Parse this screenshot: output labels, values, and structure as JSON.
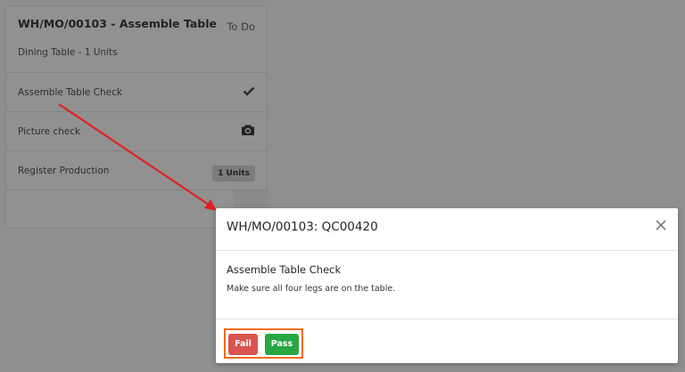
{
  "work_order": {
    "title": "WH/MO/00103 - Assemble Table",
    "state": "To Do",
    "subtitle": "Dining Table - 1 Units",
    "steps": [
      {
        "label": "Assemble Table Check",
        "icon": "checkmark-icon"
      },
      {
        "label": "Picture check",
        "icon": "camera-icon"
      },
      {
        "label": "Register Production",
        "badge": "1 Units"
      }
    ]
  },
  "dialog": {
    "title": "WH/MO/00103: QC00420",
    "check_title": "Assemble Table Check",
    "check_description": "Make sure all four legs are on the table.",
    "fail_label": "Fail",
    "pass_label": "Pass"
  },
  "colors": {
    "overlay_background": "#8f8f8f",
    "fail": "#d9534f",
    "pass": "#28a745",
    "highlight_box": "#f26b1d",
    "annotation_arrow": "#e02020"
  }
}
